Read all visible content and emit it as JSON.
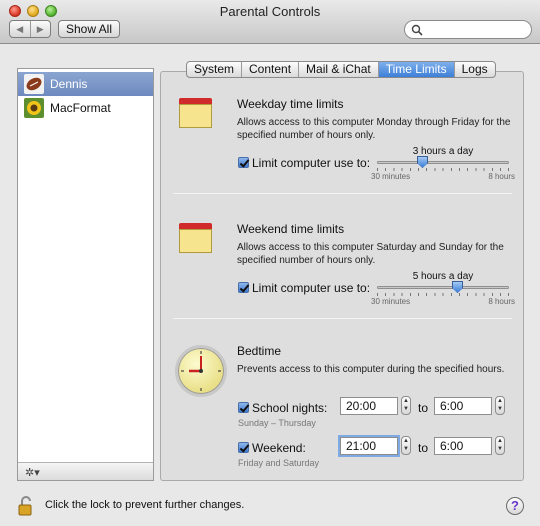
{
  "window": {
    "title": "Parental Controls"
  },
  "toolbar": {
    "show_all": "Show All",
    "back": "◀",
    "forward": "▶"
  },
  "users": [
    {
      "name": "Dennis",
      "selected": true
    },
    {
      "name": "MacFormat",
      "selected": false
    }
  ],
  "tabs": [
    "System",
    "Content",
    "Mail & iChat",
    "Time Limits",
    "Logs"
  ],
  "active_tab": "Time Limits",
  "weekday": {
    "title": "Weekday time limits",
    "description": "Allows access to this computer Monday through Friday for the specified number of hours only.",
    "checkbox_label": "Limit computer use to:",
    "checked": true,
    "value_label": "3 hours a day",
    "hours": 3,
    "min_label": "30 minutes",
    "max_label": "8 hours"
  },
  "weekend": {
    "title": "Weekend time limits",
    "description": "Allows access to this computer Saturday and Sunday for the specified number of hours only.",
    "checkbox_label": "Limit computer use to:",
    "checked": true,
    "value_label": "5 hours a day",
    "hours": 5,
    "min_label": "30 minutes",
    "max_label": "8 hours"
  },
  "bedtime": {
    "title": "Bedtime",
    "description": "Prevents access to this computer during the specified hours.",
    "school_label": "School nights:",
    "school_sub": "Sunday – Thursday",
    "school_from": "20:00",
    "school_to": "6:00",
    "weekend_label": "Weekend:",
    "weekend_sub": "Friday and Saturday",
    "weekend_from": "21:00",
    "weekend_to": "6:00",
    "to_label": "to"
  },
  "footer": {
    "lock_text": "Click the lock to prevent further changes.",
    "help": "?"
  },
  "colors": {
    "accent": "#3d7fd8",
    "selection": "#7a95c8",
    "calendar_header": "#d02a2a"
  }
}
